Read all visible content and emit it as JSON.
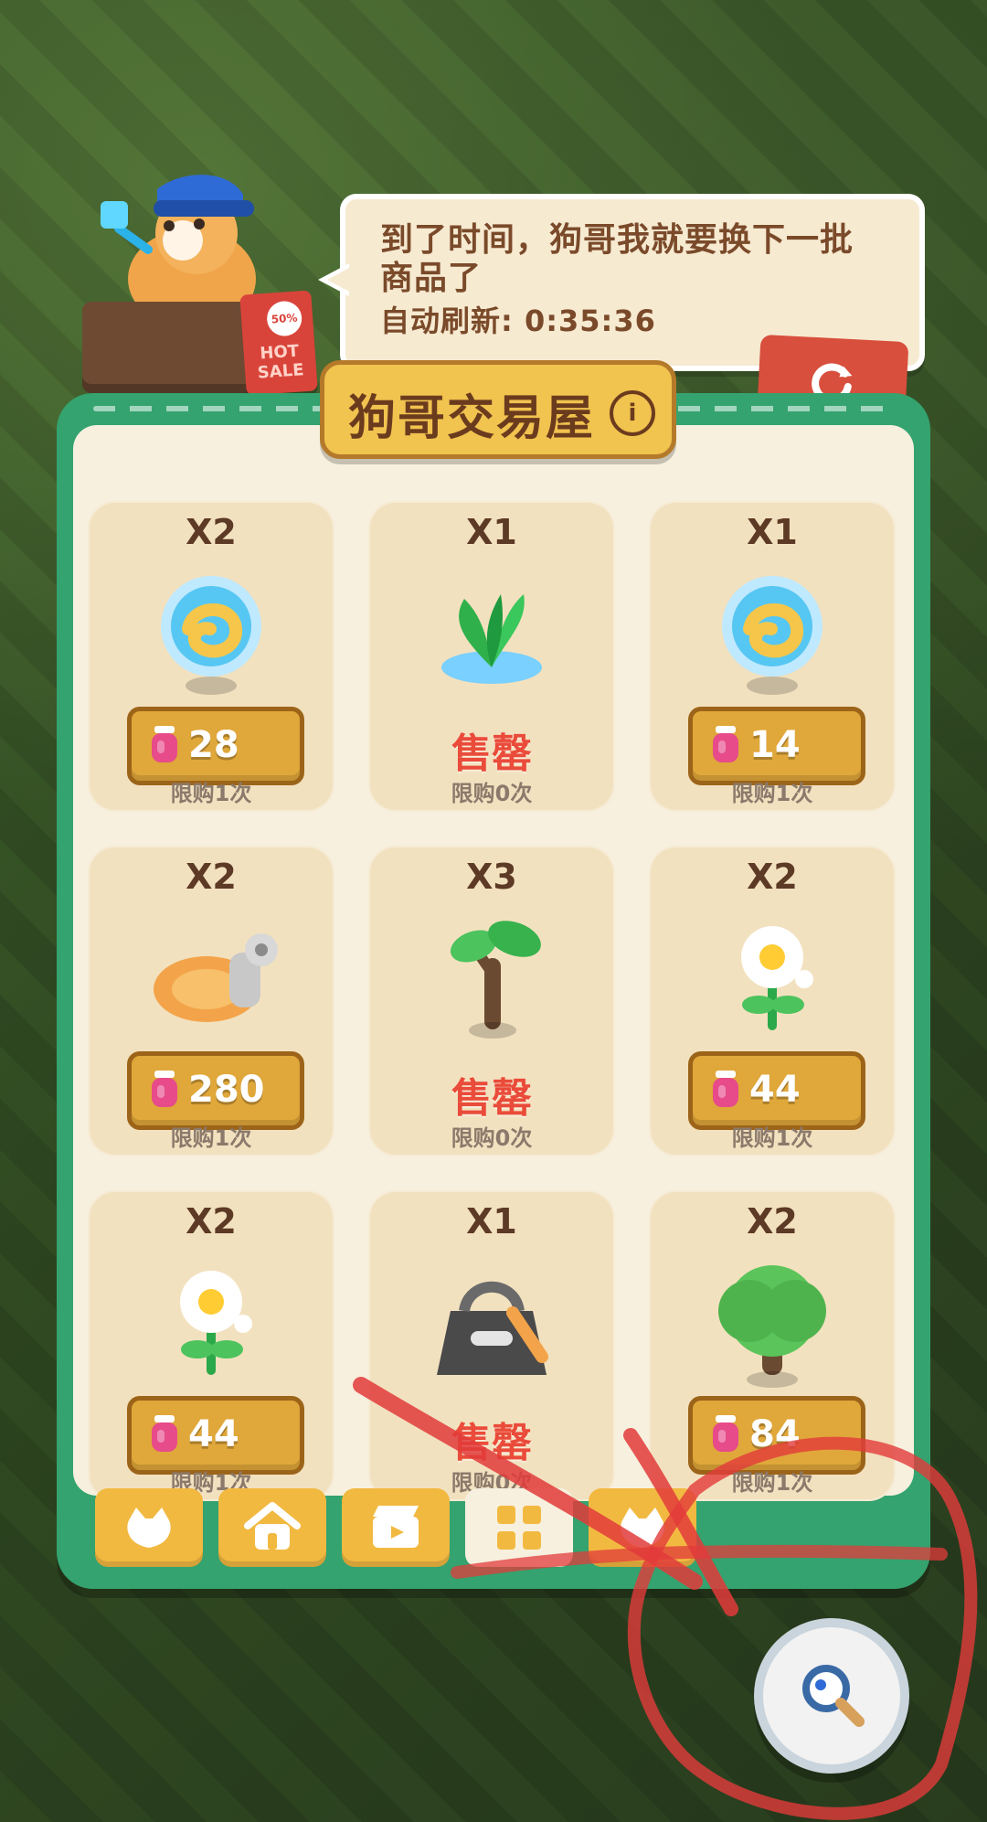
{
  "bubble": {
    "line1": "到了时间，狗哥我就要换下一批",
    "line2": "商品了",
    "refresh_text": "自动刷新: 0:35:36"
  },
  "hot_sign": {
    "off": "50% OFF",
    "hot": "HOT SALE"
  },
  "title": "狗哥交易屋",
  "items": [
    {
      "qty": "X2",
      "icon": "magic-orb",
      "price": "28",
      "sold_out": null,
      "limit": "限购1次"
    },
    {
      "qty": "X1",
      "icon": "grass-plant",
      "price": null,
      "sold_out": "售罄",
      "limit": "限购0次"
    },
    {
      "qty": "X1",
      "icon": "magic-orb",
      "price": "14",
      "sold_out": null,
      "limit": "限购1次"
    },
    {
      "qty": "X2",
      "icon": "wind-up-key",
      "price": "280",
      "sold_out": null,
      "limit": "限购1次"
    },
    {
      "qty": "X3",
      "icon": "sapling",
      "price": null,
      "sold_out": "售罄",
      "limit": "限购0次"
    },
    {
      "qty": "X2",
      "icon": "daisy-flower",
      "price": "44",
      "sold_out": null,
      "limit": "限购1次"
    },
    {
      "qty": "X2",
      "icon": "daisy-flower",
      "price": "44",
      "sold_out": null,
      "limit": "限购1次"
    },
    {
      "qty": "X1",
      "icon": "dark-bag",
      "price": null,
      "sold_out": "售罄",
      "limit": "限购0次"
    },
    {
      "qty": "X2",
      "icon": "tree",
      "price": "84",
      "sold_out": null,
      "limit": "限购1次"
    }
  ],
  "tabs": [
    {
      "icon": "cat-head-icon",
      "active": false
    },
    {
      "icon": "house-icon",
      "active": false
    },
    {
      "icon": "clapperboard-icon",
      "active": false
    },
    {
      "icon": "grid-icon",
      "active": true
    },
    {
      "icon": "cat-head-icon",
      "active": false
    }
  ],
  "colors": {
    "panel_green": "#34A36F",
    "price_gold": "#E0A73A",
    "soldout_red": "#EA4B3A"
  }
}
